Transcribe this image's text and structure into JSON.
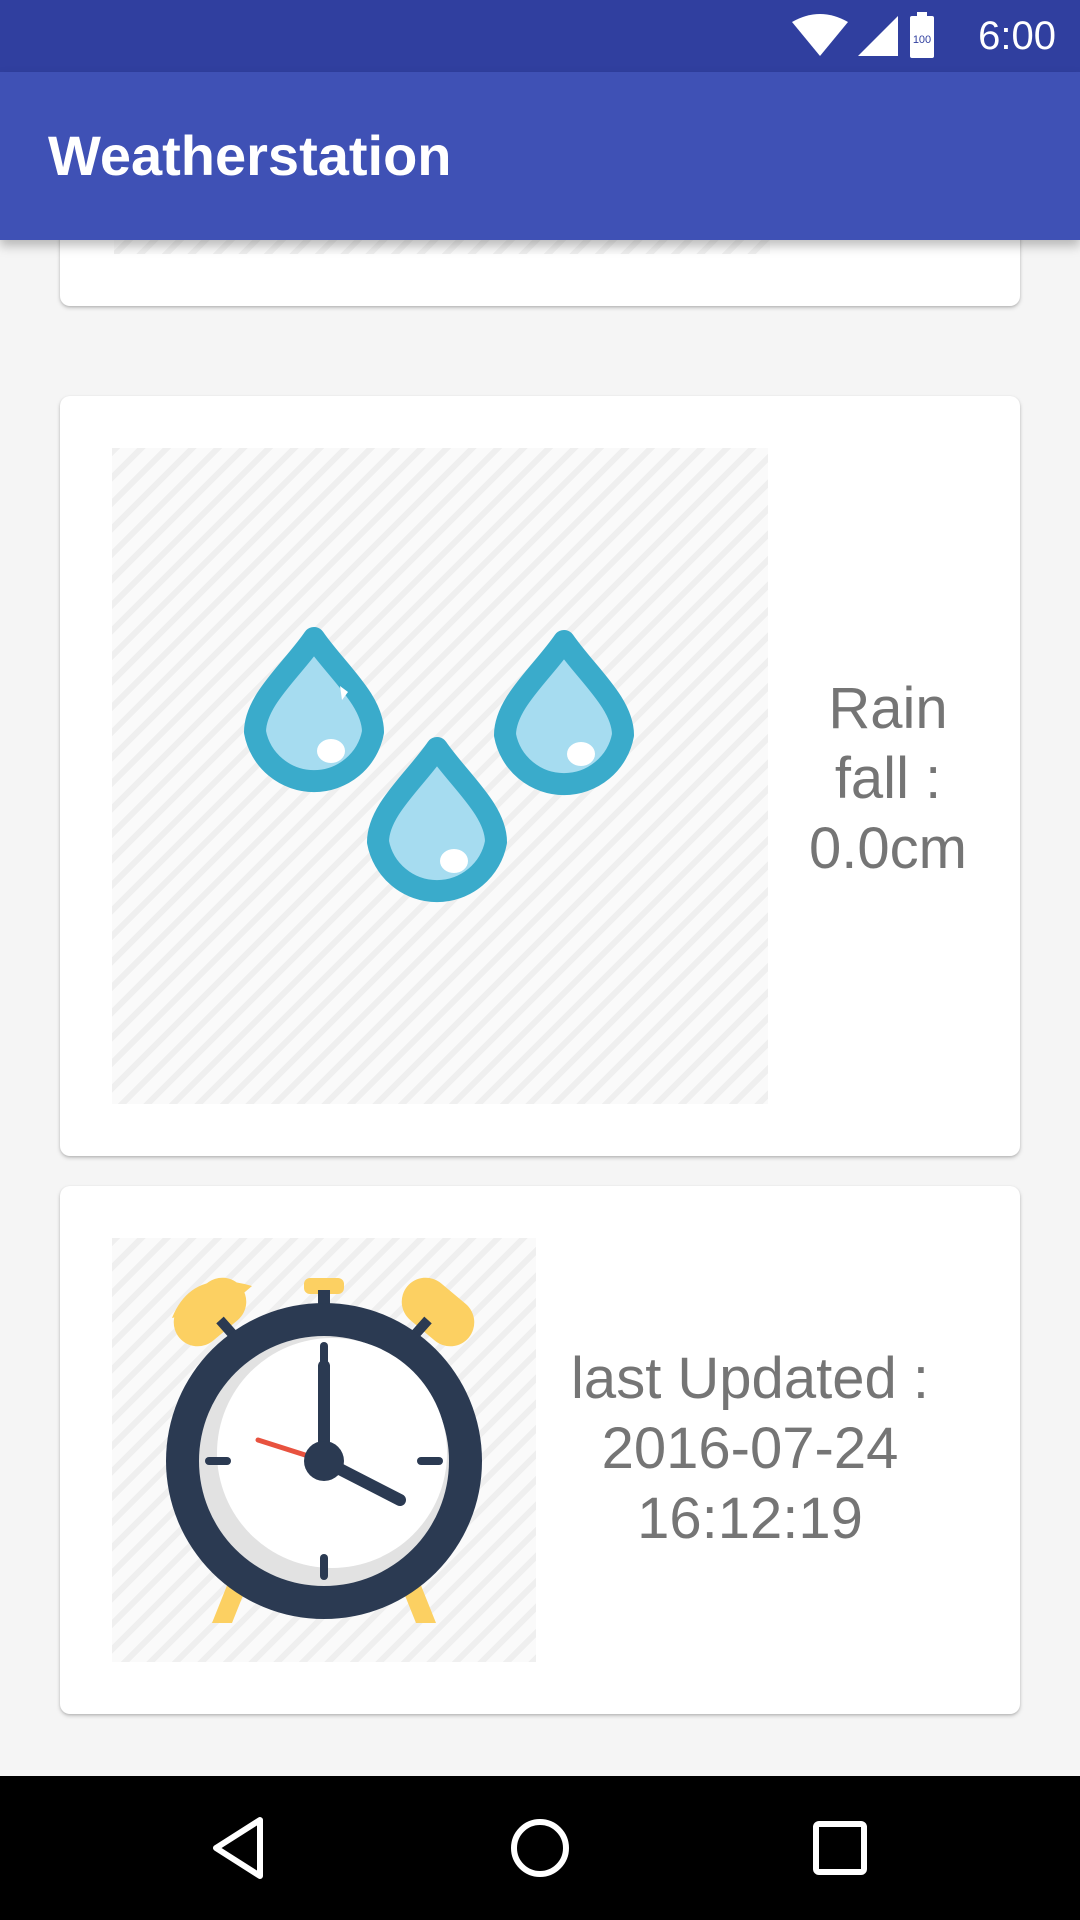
{
  "status_bar": {
    "time": "6:00",
    "battery_label": "100",
    "icons": [
      "wifi-icon",
      "signal-icon",
      "battery-icon"
    ]
  },
  "app_bar": {
    "title": "Weatherstation"
  },
  "cards": {
    "rainfall": {
      "icon": "raindrops-icon",
      "line1": "Rain",
      "line2": "fall :",
      "line3": "0.0cm"
    },
    "last_updated": {
      "icon": "alarm-clock-icon",
      "line1": "last Updated :",
      "line2": "2016-07-24",
      "line3": "16:12:19"
    }
  },
  "nav_bar": {
    "buttons": [
      "back-icon",
      "home-icon",
      "recents-icon"
    ]
  },
  "colors": {
    "primary": "#3f51b5",
    "primary_dark": "#303f9f",
    "drop_outline": "#3aabcb",
    "drop_fill": "#a6dcf0",
    "clock_dark": "#2b3a52",
    "clock_bell": "#fcd062",
    "clock_second_hand": "#e8523f"
  }
}
